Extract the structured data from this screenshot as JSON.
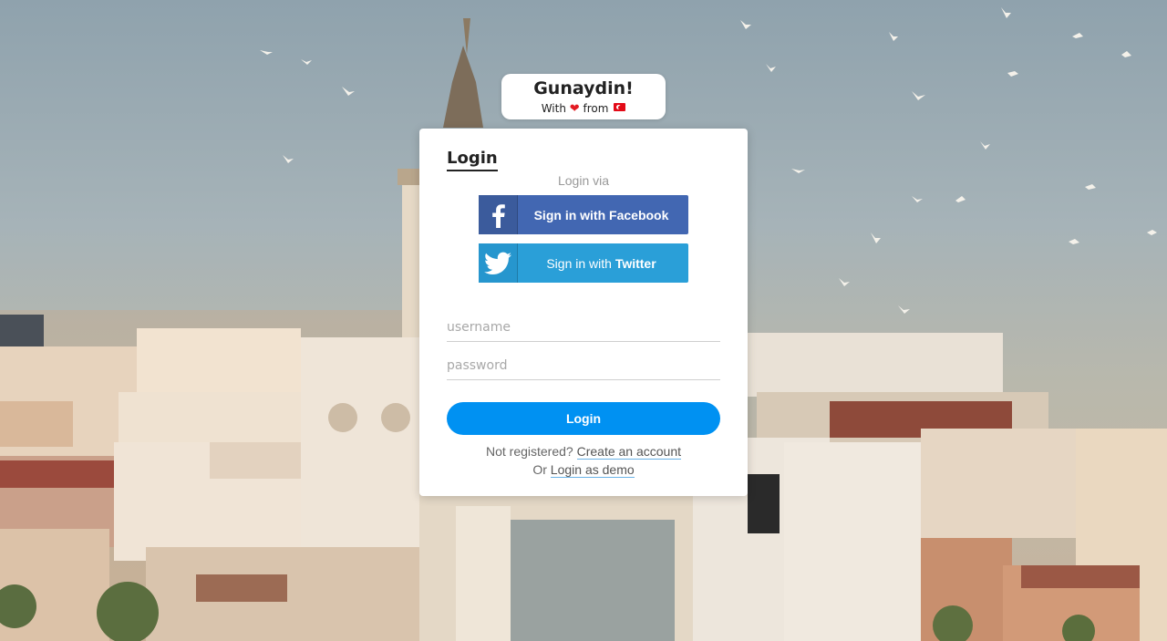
{
  "greeting": {
    "title": "Gunaydin!",
    "with_text": "With",
    "heart_icon": "heart-icon",
    "from_text": "from",
    "flag_icon": "turkey-flag-icon"
  },
  "login_card": {
    "title": "Login",
    "login_via": "Login via",
    "facebook_label": "Sign in with Facebook",
    "twitter_prefix": "Sign in with ",
    "twitter_brand": "Twitter",
    "username_placeholder": "username",
    "password_placeholder": "password",
    "login_button": "Login",
    "not_registered": "Not registered?",
    "create_account": "Create an account",
    "or_text": "Or",
    "login_demo": "Login as demo"
  },
  "colors": {
    "facebook": "#4267b2",
    "twitter": "#2a9fd8",
    "primary": "#0091f2"
  }
}
